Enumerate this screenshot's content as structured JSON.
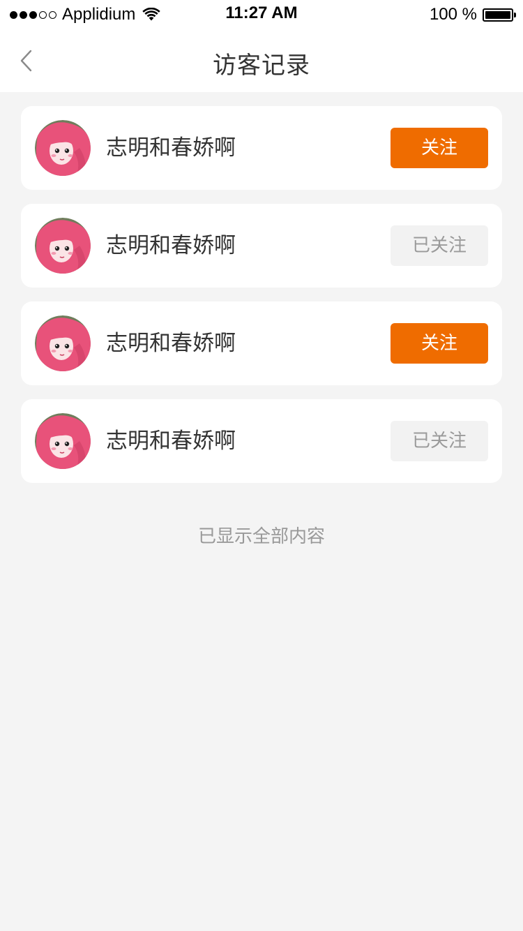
{
  "status_bar": {
    "carrier": "Applidium",
    "time": "11:27 AM",
    "battery": "100 %",
    "signal_dots_filled": 3,
    "signal_dots_total": 5,
    "icons": [
      "wifi-icon",
      "battery-icon"
    ]
  },
  "nav": {
    "title": "访客记录",
    "back_icon": "chevron-left-icon"
  },
  "visitors": [
    {
      "name": "志明和春娇啊",
      "button_label": "关注",
      "followed": false
    },
    {
      "name": "志明和春娇啊",
      "button_label": "已关注",
      "followed": true
    },
    {
      "name": "志明和春娇啊",
      "button_label": "关注",
      "followed": false
    },
    {
      "name": "志明和春娇啊",
      "button_label": "已关注",
      "followed": true
    }
  ],
  "footer": {
    "end_text": "已显示全部内容"
  },
  "colors": {
    "accent": "#ef6c00",
    "followed_bg": "#f2f2f2",
    "followed_text": "#9a9a9a",
    "page_bg": "#f4f4f4",
    "card_bg": "#ffffff"
  }
}
